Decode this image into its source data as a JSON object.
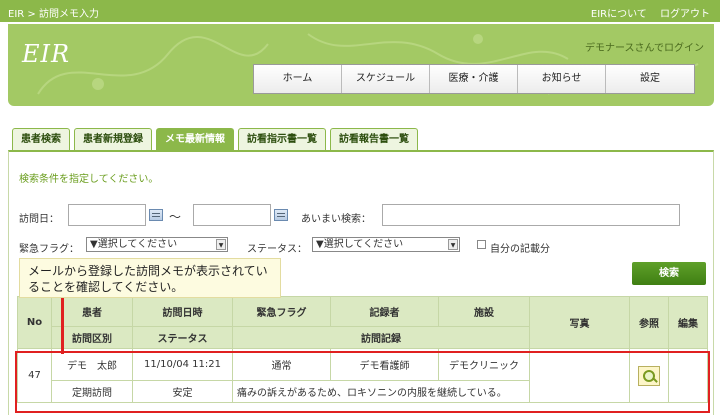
{
  "topbar": {
    "breadcrumb": "EIR > 訪問メモ入力",
    "about_link": "EIRについて",
    "logout_link": "ログアウト"
  },
  "header": {
    "logo": "EIR",
    "login_text": "デモナースさんでログイン",
    "nav": [
      "ホーム",
      "スケジュール",
      "医療・介護",
      "お知らせ",
      "設定"
    ]
  },
  "tabs": [
    "患者検索",
    "患者新規登録",
    "メモ最新情報",
    "訪看指示書一覧",
    "訪看報告書一覧"
  ],
  "form": {
    "hint": "検索条件を指定してください。",
    "visit_date_label": "訪問日：",
    "range_sep": "〜",
    "fuzzy_label": "あいまい検索：",
    "urgency_label": "緊急フラグ：",
    "urgency_value": "▼選択してください",
    "status_label": "ステータス：",
    "status_value": "▼選択してください",
    "own_records_label": "自分の記載分",
    "search_button": "検索"
  },
  "callout": "メールから登録した訪問メモが表示されていることを確認してください。",
  "table": {
    "headers_row1": [
      "No",
      "患者",
      "訪問日時",
      "緊急フラグ",
      "記録者",
      "施設",
      "写真",
      "参照",
      "編集"
    ],
    "headers_row2": [
      "訪問区別",
      "ステータス",
      "訪問記録"
    ],
    "rows": [
      {
        "no": "47",
        "patient": "デモ　太郎",
        "datetime": "11/10/04 11:21",
        "urgency": "通常",
        "recorder": "デモ看護師",
        "facility": "デモクリニック",
        "visit_type": "定期訪問",
        "status": "安定",
        "memo": "痛みの訴えがあるため、ロキソニンの内服を継続している。"
      }
    ]
  },
  "colors": {
    "brand_green": "#8cb84a",
    "header_green": "#a3c964",
    "highlight_red": "#e02020"
  }
}
